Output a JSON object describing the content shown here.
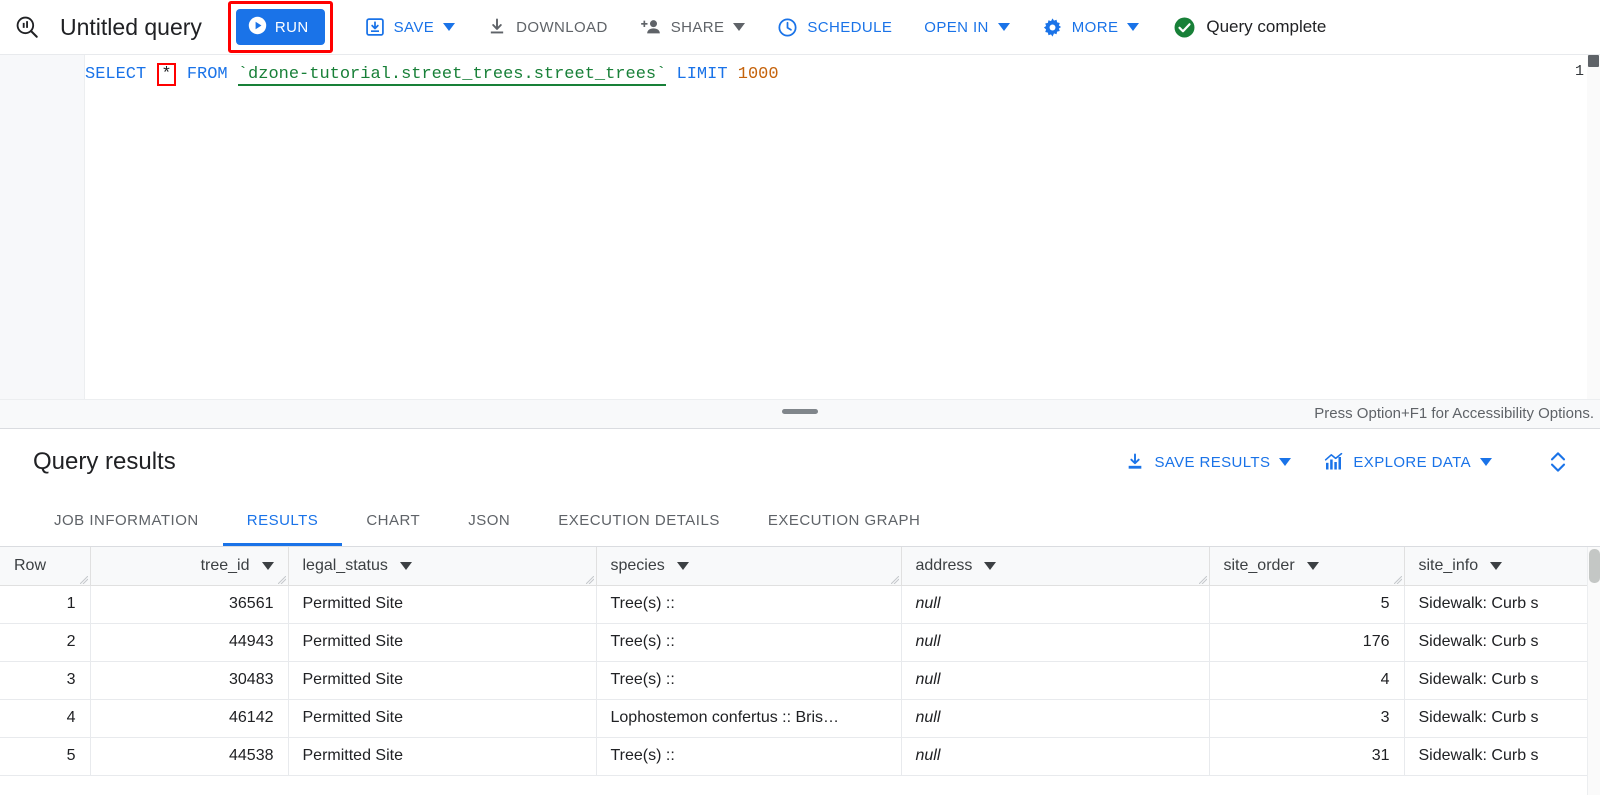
{
  "toolbar": {
    "logo_icon": "bigquery-icon",
    "query_title": "Untitled query",
    "run_label": "RUN",
    "save_label": "SAVE",
    "download_label": "DOWNLOAD",
    "share_label": "SHARE",
    "schedule_label": "SCHEDULE",
    "open_in_label": "OPEN IN",
    "more_label": "MORE",
    "status_label": "Query complete",
    "accent_blue": "#1a73e8",
    "grey_text": "#5f6368",
    "status_green": "#188038",
    "highlight_red": "#ff0000"
  },
  "editor": {
    "line_number": "1",
    "tokens": {
      "select": "SELECT",
      "star": "*",
      "from": "FROM",
      "table": "`dzone-tutorial.street_trees.street_trees`",
      "limit": "LIMIT",
      "limit_value": "1000"
    },
    "full_query": "SELECT * FROM `dzone-tutorial.street_trees.street_trees` LIMIT 1000"
  },
  "splitter": {
    "accessibility_hint": "Press Option+F1 for Accessibility Options."
  },
  "results": {
    "title": "Query results",
    "save_results_label": "SAVE RESULTS",
    "explore_data_label": "EXPLORE DATA",
    "tabs": [
      {
        "label": "JOB INFORMATION",
        "active": false
      },
      {
        "label": "RESULTS",
        "active": true
      },
      {
        "label": "CHART",
        "active": false
      },
      {
        "label": "JSON",
        "active": false
      },
      {
        "label": "EXECUTION DETAILS",
        "active": false
      },
      {
        "label": "EXECUTION GRAPH",
        "active": false
      }
    ],
    "columns": [
      {
        "label": "Row",
        "sortable": false,
        "align": "right"
      },
      {
        "label": "tree_id",
        "sortable": true,
        "align": "right"
      },
      {
        "label": "legal_status",
        "sortable": true,
        "align": "left"
      },
      {
        "label": "species",
        "sortable": true,
        "align": "left"
      },
      {
        "label": "address",
        "sortable": true,
        "align": "left"
      },
      {
        "label": "site_order",
        "sortable": true,
        "align": "right"
      },
      {
        "label": "site_info",
        "sortable": true,
        "align": "left"
      }
    ],
    "rows": [
      {
        "row": "1",
        "tree_id": "36561",
        "legal_status": "Permitted Site",
        "species": "Tree(s) ::",
        "address": "null",
        "site_order": "5",
        "site_info": "Sidewalk: Curb s"
      },
      {
        "row": "2",
        "tree_id": "44943",
        "legal_status": "Permitted Site",
        "species": "Tree(s) ::",
        "address": "null",
        "site_order": "176",
        "site_info": "Sidewalk: Curb s"
      },
      {
        "row": "3",
        "tree_id": "30483",
        "legal_status": "Permitted Site",
        "species": "Tree(s) ::",
        "address": "null",
        "site_order": "4",
        "site_info": "Sidewalk: Curb s"
      },
      {
        "row": "4",
        "tree_id": "46142",
        "legal_status": "Permitted Site",
        "species": "Lophostemon confertus :: Bris…",
        "address": "null",
        "site_order": "3",
        "site_info": "Sidewalk: Curb s"
      },
      {
        "row": "5",
        "tree_id": "44538",
        "legal_status": "Permitted Site",
        "species": "Tree(s) ::",
        "address": "null",
        "site_order": "31",
        "site_info": "Sidewalk: Curb s"
      }
    ]
  }
}
